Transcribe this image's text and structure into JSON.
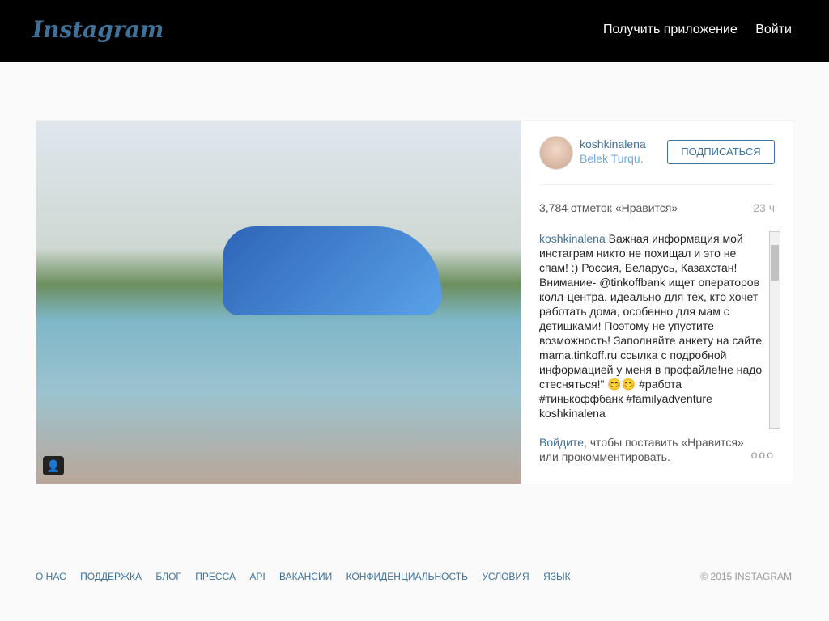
{
  "app": {
    "logo": "Instagram",
    "nav": {
      "get_app": "Получить приложение",
      "login": "Войти"
    }
  },
  "post": {
    "username": "koshkinalena",
    "location": "Belek Turqu.",
    "follow_label": "ПОДПИСАТЬСЯ",
    "likes": "3,784 отметок «Нравится»",
    "time": "23 ч",
    "caption_user": "koshkinalena",
    "caption_text": "Важная информация мой инстаграм никто не похищал и это не спам! :) Россия, Беларусь, Казахстан! Внимание- @tinkoffbank ищет операторов колл-центра, идеально для тех, кто хочет работать дома, особенно для мам с детишками! Поэтому не упустите возможность! Заполняйте анкету на сайте mama.tinkoff.ru ссылка с подробной информацией у меня в профайле!не надо стесняться!\" 😊😊 #работа #тинькоффбанк #familyadventure koshkinalena",
    "login_link": "Войдите",
    "login_rest": ", чтобы поставить «Нравится» или прокомментировать.",
    "more": "ооо"
  },
  "footer": {
    "links": [
      "О НАС",
      "ПОДДЕРЖКА",
      "БЛОГ",
      "ПРЕССА",
      "API",
      "ВАКАНСИИ",
      "КОНФИДЕНЦИАЛЬНОСТЬ",
      "УСЛОВИЯ",
      "ЯЗЫК"
    ],
    "copyright": "© 2015 INSTAGRAM"
  },
  "icons": {
    "tag": "person-tag-icon",
    "avatar": "avatar"
  }
}
